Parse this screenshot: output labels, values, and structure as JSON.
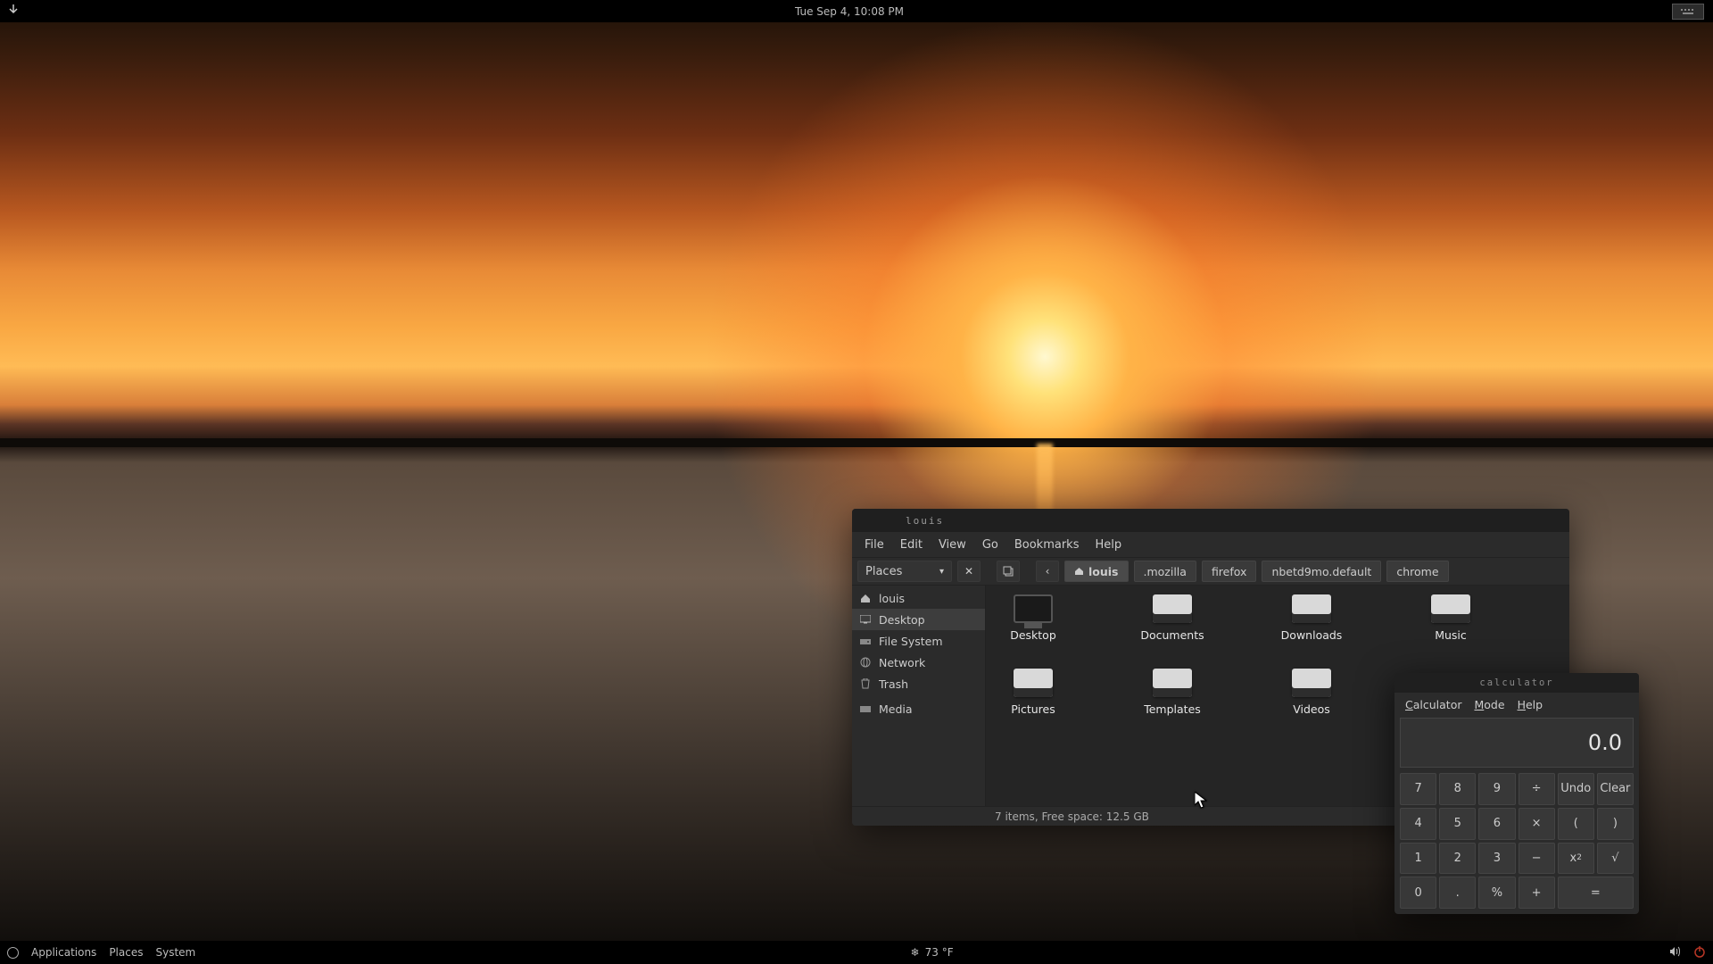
{
  "top_panel": {
    "clock": "Tue Sep  4, 10:08 PM"
  },
  "bottom_panel": {
    "applications": "Applications",
    "places": "Places",
    "system": "System",
    "temperature": "73 °F"
  },
  "file_manager": {
    "title": "louis",
    "menus": [
      "File",
      "Edit",
      "View",
      "Go",
      "Bookmarks",
      "Help"
    ],
    "places_label": "Places",
    "path": [
      {
        "label": "louis",
        "home": true
      },
      {
        "label": ".mozilla",
        "home": false
      },
      {
        "label": "firefox",
        "home": false
      },
      {
        "label": "nbetd9mo.default",
        "home": false
      },
      {
        "label": "chrome",
        "home": false
      }
    ],
    "sidebar": [
      {
        "label": "louis",
        "icon": "home",
        "selected": false
      },
      {
        "label": "Desktop",
        "icon": "desktop",
        "selected": true
      },
      {
        "label": "File System",
        "icon": "drive",
        "selected": false
      },
      {
        "label": "Network",
        "icon": "network",
        "selected": false
      },
      {
        "label": "Trash",
        "icon": "trash",
        "selected": false
      },
      {
        "label": "Media",
        "icon": "media",
        "selected": false
      }
    ],
    "folders": [
      {
        "label": "Desktop",
        "type": "desktop"
      },
      {
        "label": "Documents",
        "type": "folder"
      },
      {
        "label": "Downloads",
        "type": "folder"
      },
      {
        "label": "Music",
        "type": "folder"
      },
      {
        "label": "Pictures",
        "type": "folder"
      },
      {
        "label": "Templates",
        "type": "folder"
      },
      {
        "label": "Videos",
        "type": "folder"
      }
    ],
    "status": "7 items, Free space: 12.5 GB"
  },
  "calculator": {
    "title": "calculator",
    "menus": [
      "Calculator",
      "Mode",
      "Help"
    ],
    "display": "0.0",
    "buttons": [
      [
        "7",
        "8",
        "9",
        "÷",
        "Undo",
        "Clear"
      ],
      [
        "4",
        "5",
        "6",
        "×",
        "(",
        ")"
      ],
      [
        "1",
        "2",
        "3",
        "−",
        "x²",
        "√"
      ],
      [
        "0",
        ".",
        "%",
        "+",
        "=",
        "="
      ]
    ]
  }
}
